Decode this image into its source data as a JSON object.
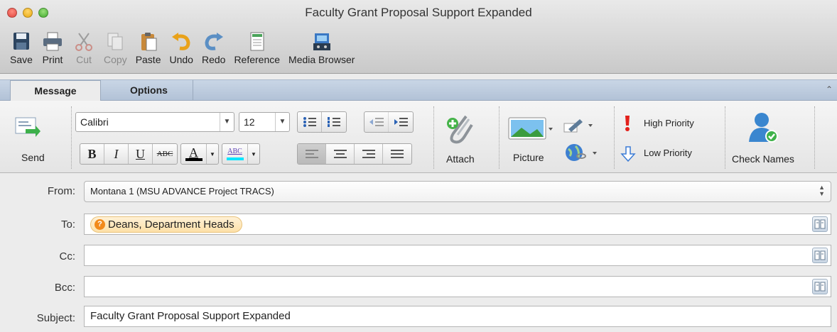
{
  "window": {
    "title": "Faculty Grant Proposal Support Expanded"
  },
  "toolbar": {
    "save": "Save",
    "print": "Print",
    "cut": "Cut",
    "copy": "Copy",
    "paste": "Paste",
    "undo": "Undo",
    "redo": "Redo",
    "reference": "Reference",
    "media_browser": "Media Browser"
  },
  "tabs": {
    "message": "Message",
    "options": "Options"
  },
  "ribbon": {
    "send": "Send",
    "font_name": "Calibri",
    "font_size": "12",
    "bold": "B",
    "italic": "I",
    "underline": "U",
    "strikethrough": "ABC",
    "font_color": "A",
    "highlight": "ABC",
    "attach": "Attach",
    "picture": "Picture",
    "high_priority": "High Priority",
    "low_priority": "Low Priority",
    "check_names": "Check Names"
  },
  "header": {
    "from_label": "From:",
    "from_value": "Montana 1 (MSU ADVANCE Project TRACS)",
    "to_label": "To:",
    "to_recipient": "Deans, Department Heads",
    "cc_label": "Cc:",
    "bcc_label": "Bcc:",
    "subject_label": "Subject:",
    "subject_value": "Faculty Grant Proposal Support Expanded"
  },
  "colors": {
    "font_color_bar": "#000000",
    "highlight_bar": "#00e5ff",
    "accent_tab": "#b2c2d7"
  }
}
